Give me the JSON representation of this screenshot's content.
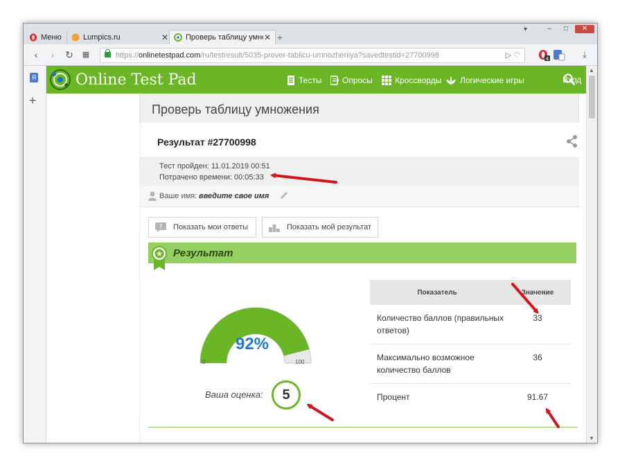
{
  "browser": {
    "menu_label": "Меню",
    "tabs": [
      {
        "title": "Lumpics.ru"
      },
      {
        "title": "Проверь таблицу умножения"
      }
    ],
    "url_scheme": "https://",
    "url_host": "onlinetestpad.com",
    "url_path": "/ru/testresult/5035-prover-tablicu-umnozheniya?savedtestid=27700998",
    "url_badge_count": "4",
    "sidebar_ext_label": "Я"
  },
  "site": {
    "logo_text": "Online Test Pad",
    "nav": {
      "tests": "Тесты",
      "polls": "Опросы",
      "crosswords": "Кроссворды",
      "games": "Логические игры",
      "login": "Вход"
    },
    "brand_color": "#6bb626"
  },
  "page": {
    "title": "Проверь таблицу умножения",
    "result_number": "Результат #27700998",
    "passed": "Тест пройден: 11.01.2019 00:51",
    "time_spent": "Потрачено времени: 00:05:33",
    "name_label": "Ваше имя:",
    "name_value": "введите свое имя",
    "btn_show_answers": "Показать мои ответы",
    "btn_show_result": "Показать мой результат",
    "section_title": "Результат",
    "gauge": {
      "percent_label": "92%",
      "value": 92,
      "min": "0",
      "max": "100"
    },
    "grade_label": "Ваша оценка:",
    "grade_value": "5",
    "table": {
      "col_indicator": "Показатель",
      "col_value": "Значение",
      "rows": [
        {
          "label": "Количество баллов (правильных ответов)",
          "value": "33"
        },
        {
          "label": "Максимально возможное количество баллов",
          "value": "36"
        },
        {
          "label": "Процент",
          "value": "91.67"
        }
      ]
    }
  },
  "colors": {
    "arrow": "#d0161c",
    "gauge_fill": "#6bb626",
    "percent": "#1b7bd3"
  }
}
